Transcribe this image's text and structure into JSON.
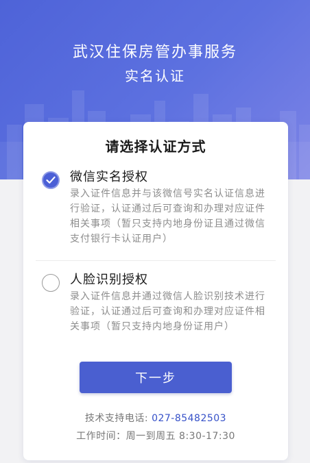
{
  "header": {
    "title": "武汉住保房管办事服务",
    "subtitle": "实名认证"
  },
  "card": {
    "title": "请选择认证方式",
    "options": [
      {
        "title": "微信实名授权",
        "description": "录入证件信息并与该微信号实名认证信息进行验证，认证通过后可查询和办理对应证件相关事项（暂只支持内地身份证且通过微信支付银行卡认证用户）",
        "selected": true
      },
      {
        "title": "人脸识别授权",
        "description": "录入证件信息并通过微信人脸识别技术进行验证，认证通过后可查询和办理对应证件相关事项（暂只支持内地身份证用户）",
        "selected": false
      }
    ],
    "next_label": "下一步",
    "support_label": "技术支持电话: ",
    "support_phone": "027-85482503",
    "hours": "工作时间：周一到周五 8:30-17:30"
  },
  "icons": {
    "selected": "checkmark-icon",
    "unselected": "empty-radio"
  },
  "colors": {
    "header_gradient_start": "#4e63d8",
    "header_gradient_end": "#7c83e6",
    "primary": "#4a5fd0",
    "phone_link": "#3550c8",
    "description_text": "#8c8c8c"
  }
}
